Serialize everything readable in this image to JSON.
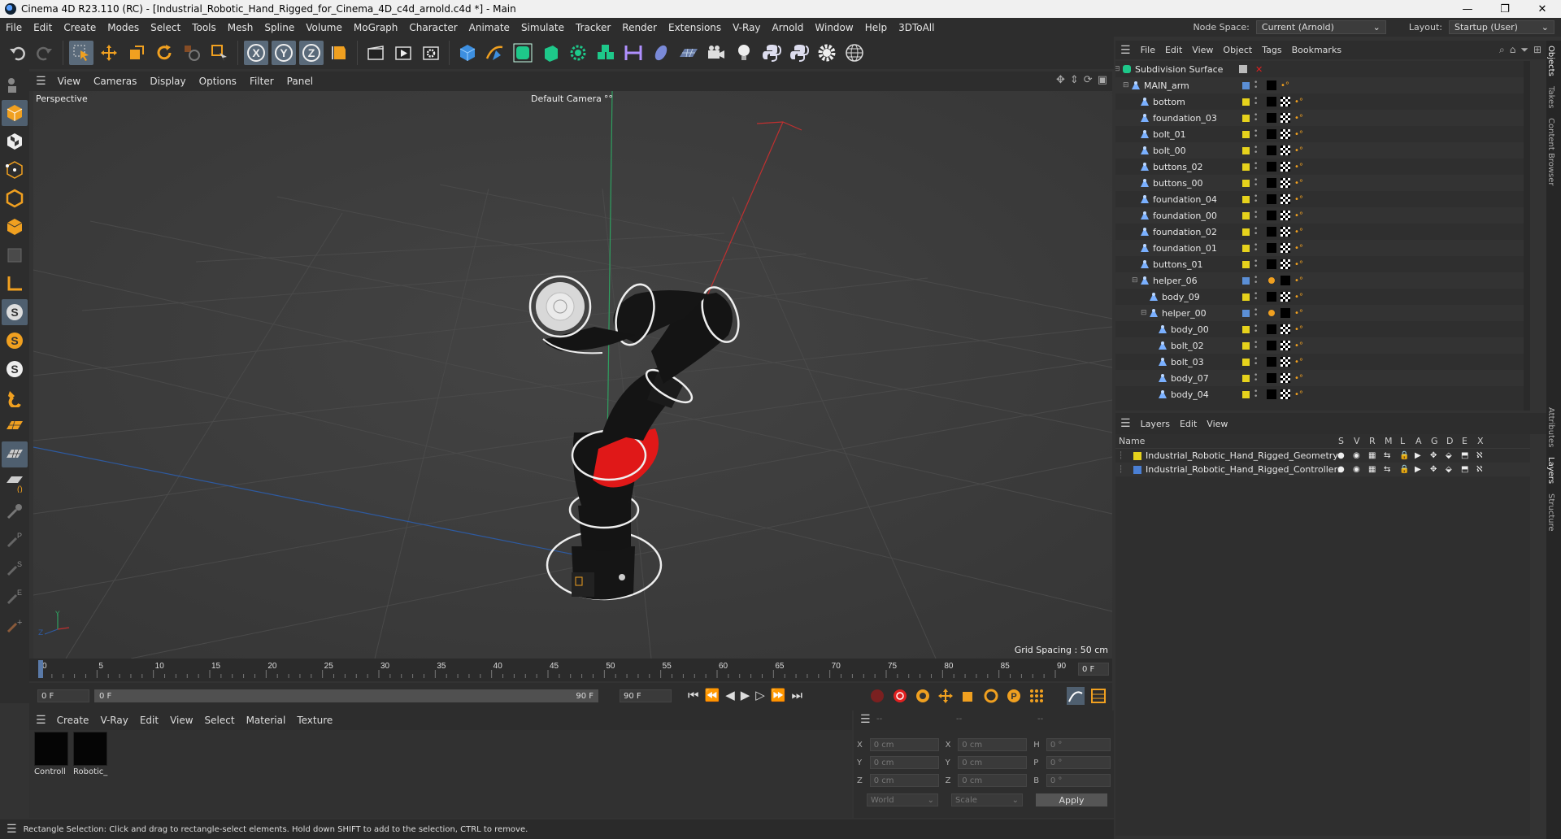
{
  "window": {
    "title": "Cinema 4D R23.110 (RC) - [Industrial_Robotic_Hand_Rigged_for_Cinema_4D_c4d_arnold.c4d *] - Main",
    "minimize": "—",
    "maximize": "❐",
    "close": "✕"
  },
  "menubar": {
    "items": [
      "File",
      "Edit",
      "Create",
      "Modes",
      "Select",
      "Tools",
      "Mesh",
      "Spline",
      "Volume",
      "MoGraph",
      "Character",
      "Animate",
      "Simulate",
      "Tracker",
      "Render",
      "Extensions",
      "V-Ray",
      "Arnold",
      "Window",
      "Help",
      "3DToAll"
    ],
    "node_space_label": "Node Space:",
    "node_space_value": "Current (Arnold)",
    "layout_label": "Layout:",
    "layout_value": "Startup (User)"
  },
  "viewport": {
    "menu": [
      "View",
      "Cameras",
      "Display",
      "Options",
      "Filter",
      "Panel"
    ],
    "label": "Perspective",
    "camera": "Default Camera",
    "camera_suffix": "°°",
    "grid_spacing": "Grid Spacing : 50 cm",
    "axis_y": "Y",
    "axis_z": "Z",
    "axis_x": "X"
  },
  "timeline": {
    "ticks": [
      "0",
      "5",
      "10",
      "15",
      "20",
      "25",
      "30",
      "35",
      "40",
      "45",
      "50",
      "55",
      "60",
      "65",
      "70",
      "75",
      "80",
      "85",
      "90"
    ],
    "current_frame": "0 F",
    "start_field": "0 F",
    "range_start": "0 F",
    "range_end": "90 F",
    "end_field": "90 F",
    "cursor_fraction": 0.0
  },
  "material_manager": {
    "menu": [
      "Create",
      "V-Ray",
      "Edit",
      "View",
      "Select",
      "Material",
      "Texture"
    ],
    "materials": [
      {
        "name": "Controll",
        "color": "#050505"
      },
      {
        "name": "Robotic_",
        "color": "#050505"
      }
    ]
  },
  "coordinates": {
    "header": [
      "--",
      "--",
      "--"
    ],
    "rows": [
      {
        "l1": "X",
        "v1": "0 cm",
        "l2": "X",
        "v2": "0 cm",
        "l3": "H",
        "v3": "0 °"
      },
      {
        "l1": "Y",
        "v1": "0 cm",
        "l2": "Y",
        "v2": "0 cm",
        "l3": "P",
        "v3": "0 °"
      },
      {
        "l1": "Z",
        "v1": "0 cm",
        "l2": "Z",
        "v2": "0 cm",
        "l3": "B",
        "v3": "0 °"
      }
    ],
    "world": "World",
    "scale": "Scale",
    "apply": "Apply"
  },
  "statusbar": {
    "text": "Rectangle Selection: Click and drag to rectangle-select elements. Hold down SHIFT to add to the selection, CTRL to remove."
  },
  "object_manager": {
    "menu": [
      "File",
      "Edit",
      "View",
      "Object",
      "Tags",
      "Bookmarks"
    ],
    "objects": [
      {
        "name": "Subdivision Surface",
        "indent": 0,
        "dot": "#888888",
        "tag": "none",
        "icon": "subdiv"
      },
      {
        "name": "MAIN_arm",
        "indent": 1,
        "dot": "#5b8fd6",
        "tag": "black",
        "icon": "joint"
      },
      {
        "name": "bottom",
        "indent": 2,
        "dot": "#e6d21c",
        "tag": "mat",
        "icon": "joint"
      },
      {
        "name": "foundation_03",
        "indent": 2,
        "dot": "#e6d21c",
        "tag": "mat",
        "icon": "joint"
      },
      {
        "name": "bolt_01",
        "indent": 2,
        "dot": "#e6d21c",
        "tag": "mat",
        "icon": "joint"
      },
      {
        "name": "bolt_00",
        "indent": 2,
        "dot": "#e6d21c",
        "tag": "mat",
        "icon": "joint"
      },
      {
        "name": "buttons_02",
        "indent": 2,
        "dot": "#e6d21c",
        "tag": "mat",
        "icon": "joint"
      },
      {
        "name": "buttons_00",
        "indent": 2,
        "dot": "#e6d21c",
        "tag": "mat",
        "icon": "joint"
      },
      {
        "name": "foundation_04",
        "indent": 2,
        "dot": "#e6d21c",
        "tag": "mat",
        "icon": "joint"
      },
      {
        "name": "foundation_00",
        "indent": 2,
        "dot": "#e6d21c",
        "tag": "mat",
        "icon": "joint"
      },
      {
        "name": "foundation_02",
        "indent": 2,
        "dot": "#e6d21c",
        "tag": "mat",
        "icon": "joint"
      },
      {
        "name": "foundation_01",
        "indent": 2,
        "dot": "#e6d21c",
        "tag": "mat",
        "icon": "joint"
      },
      {
        "name": "buttons_01",
        "indent": 2,
        "dot": "#e6d21c",
        "tag": "mat",
        "icon": "joint"
      },
      {
        "name": "helper_06",
        "indent": 2,
        "dot": "#5b8fd6",
        "tag": "orange",
        "icon": "joint"
      },
      {
        "name": "body_09",
        "indent": 3,
        "dot": "#e6d21c",
        "tag": "mat",
        "icon": "joint"
      },
      {
        "name": "helper_00",
        "indent": 3,
        "dot": "#5b8fd6",
        "tag": "orange",
        "icon": "joint"
      },
      {
        "name": "body_00",
        "indent": 4,
        "dot": "#e6d21c",
        "tag": "mat",
        "icon": "joint"
      },
      {
        "name": "bolt_02",
        "indent": 4,
        "dot": "#e6d21c",
        "tag": "mat",
        "icon": "joint"
      },
      {
        "name": "bolt_03",
        "indent": 4,
        "dot": "#e6d21c",
        "tag": "mat",
        "icon": "joint"
      },
      {
        "name": "body_07",
        "indent": 4,
        "dot": "#e6d21c",
        "tag": "mat",
        "icon": "joint"
      },
      {
        "name": "body_04",
        "indent": 4,
        "dot": "#e6d21c",
        "tag": "mat",
        "icon": "joint"
      }
    ]
  },
  "layers": {
    "menu": [
      "Layers",
      "Edit",
      "View"
    ],
    "columns": [
      "Name",
      "S",
      "V",
      "R",
      "M",
      "L",
      "A",
      "G",
      "D",
      "E",
      "X"
    ],
    "rows": [
      {
        "name": "Industrial_Robotic_Hand_Rigged_Geometry",
        "color": "#e6d21c"
      },
      {
        "name": "Industrial_Robotic_Hand_Rigged_Controllers",
        "color": "#4a7fd4"
      }
    ]
  },
  "right_tabs": [
    "Objects",
    "Takes",
    "Content Browser",
    "Attributes",
    "Layers",
    "Structure"
  ],
  "colors": {
    "accent_orange": "#f0a020",
    "selected_blue": "#5a6a7a",
    "robot_red": "#e01818"
  }
}
